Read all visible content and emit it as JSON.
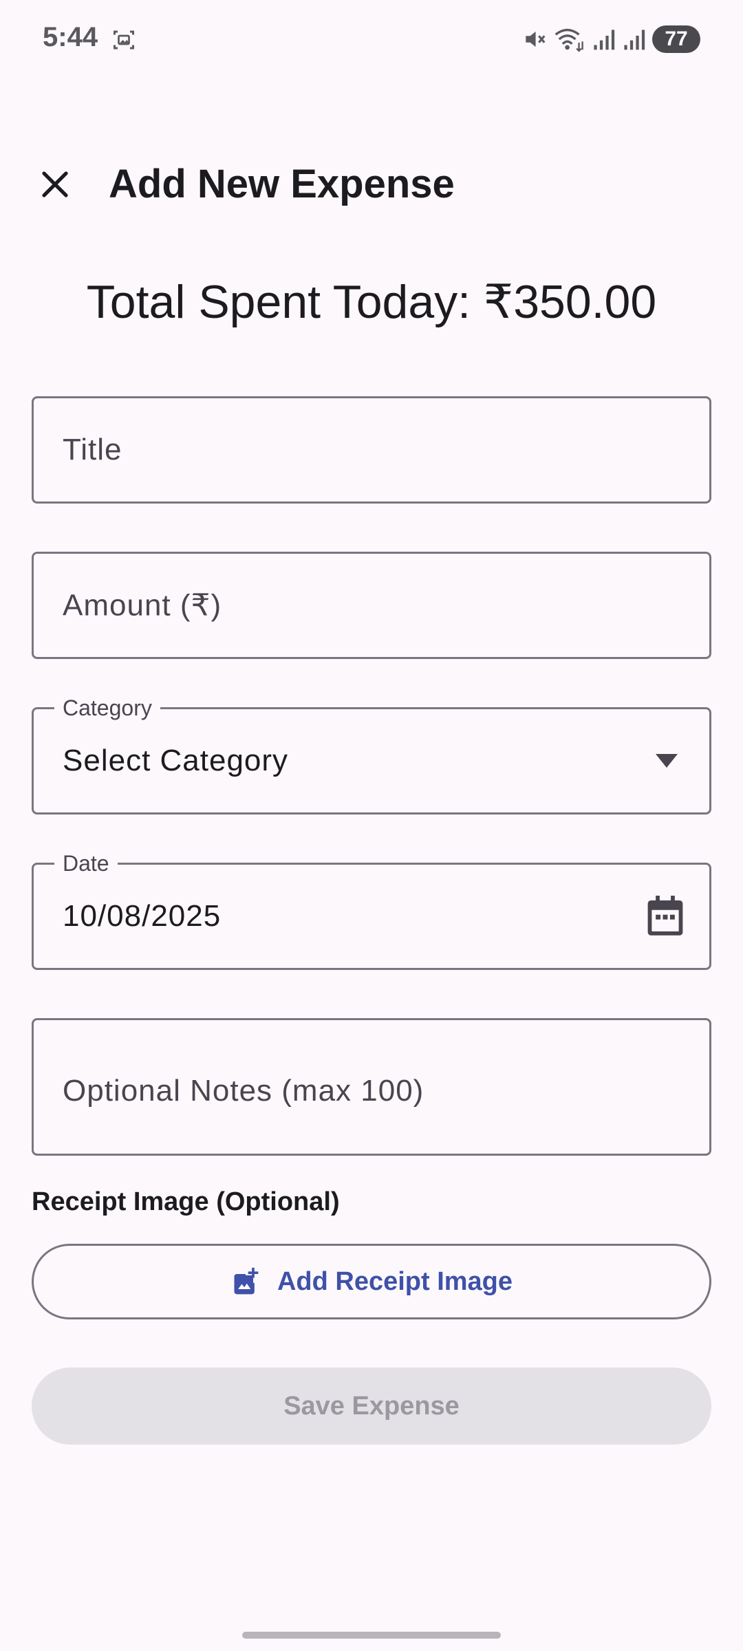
{
  "status_bar": {
    "time": "5:44",
    "battery": "77",
    "icons": [
      "screenshot-icon",
      "mute-icon",
      "wifi-icon",
      "signal-icon",
      "signal-icon"
    ]
  },
  "header": {
    "title": "Add New Expense",
    "close_icon": "close-icon"
  },
  "summary": {
    "total_spent": "Total Spent Today: ₹350.00"
  },
  "form": {
    "title_placeholder": "Title",
    "amount_placeholder": "Amount (₹)",
    "category_label": "Category",
    "category_value": "Select Category",
    "date_label": "Date",
    "date_value": "10/08/2025",
    "notes_placeholder": "Optional Notes (max 100)",
    "receipt_label": "Receipt Image (Optional)",
    "add_receipt_label": "Add Receipt Image",
    "save_label": "Save Expense"
  },
  "colors": {
    "background": "#fcf8fc",
    "accent": "#3f51a8",
    "disabled_button_bg": "#e3e1e6",
    "disabled_button_text": "#9b989f",
    "outline": "#7a7580"
  }
}
